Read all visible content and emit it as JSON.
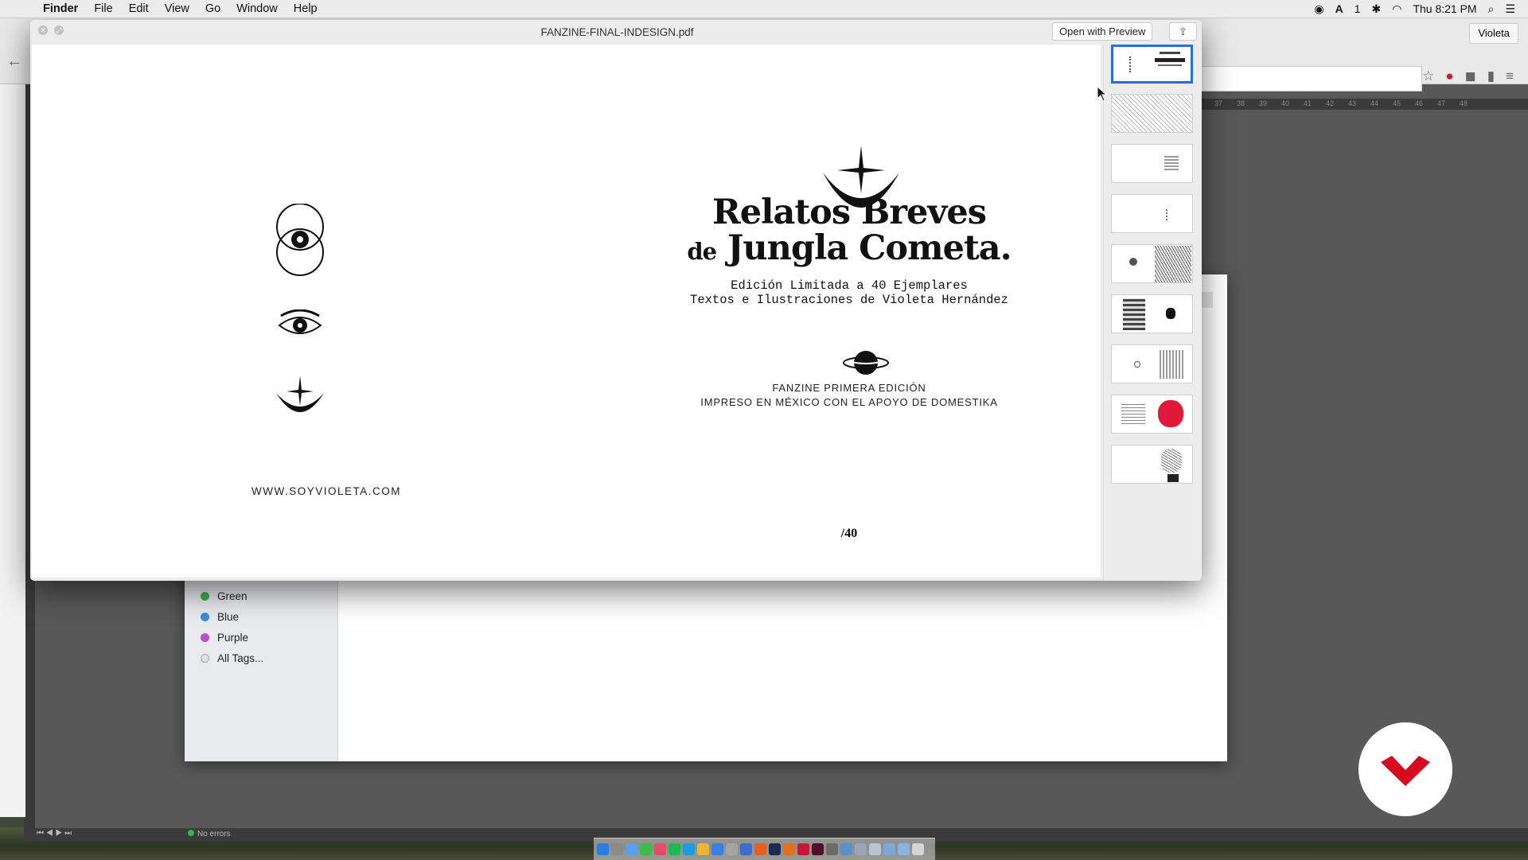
{
  "menubar": {
    "app": "Finder",
    "items": [
      "File",
      "Edit",
      "View",
      "Go",
      "Window",
      "Help"
    ],
    "clock": "Thu 8:21 PM",
    "status_count": "1"
  },
  "browser": {
    "user_button": "Violeta"
  },
  "quicklook": {
    "title": "FANZINE-FINAL-INDESIGN.pdf",
    "open_button": "Open with Preview",
    "share_icon": "share-icon",
    "page": {
      "title_line1": "Relatos Breves",
      "title_line2_prefix": "de",
      "title_line2": "Jungla Cometa.",
      "subtitle_line1": "Edición Limitada a 40 Ejemplares",
      "subtitle_line2": "Textos e Ilustraciones de Violeta Hernández",
      "edition_line1": "FANZINE PRIMERA EDICIÓN",
      "edition_line2": "IMPRESO EN MÉXICO CON EL APOYO DE DOMESTIKA",
      "count": "/40",
      "website": "WWW.SOYVIOLETA.COM"
    },
    "thumbnail_count": 9
  },
  "finder": {
    "tags": [
      {
        "label": "Green",
        "color": "#3bb34a"
      },
      {
        "label": "Blue",
        "color": "#3b8fd9"
      },
      {
        "label": "Purple",
        "color": "#b552c8"
      },
      {
        "label": "All Tags...",
        "color": "#cfcfcf"
      }
    ]
  },
  "indesign": {
    "status": "No errors",
    "ruler_ticks": [
      "37",
      "38",
      "39",
      "40",
      "41",
      "42",
      "43",
      "44",
      "45",
      "46",
      "47",
      "48"
    ]
  },
  "colors": {
    "selection": "#2a6fd6",
    "logo_red": "#d8081f"
  }
}
